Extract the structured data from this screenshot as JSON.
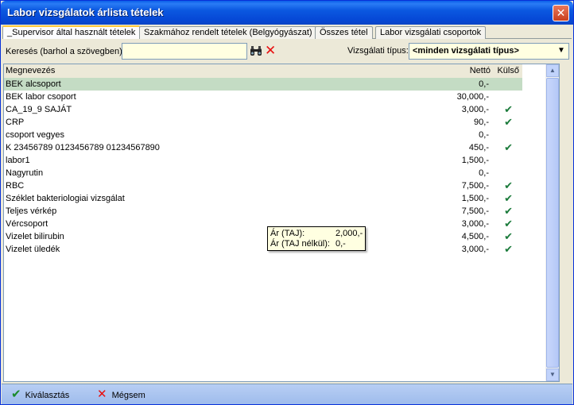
{
  "window": {
    "title": "Labor vizsgálatok árlista tételek",
    "close_glyph": "✕"
  },
  "tabs": [
    {
      "label": "_Supervisor által használt tételek",
      "active": true
    },
    {
      "label": "Szakmához rendelt tételek (Belgyógyászat)",
      "active": false
    },
    {
      "label": "Összes tétel",
      "active": false
    },
    {
      "label": "Labor vizsgálati csoportok",
      "active": false
    }
  ],
  "toolbar": {
    "search_label": "Keresés (barhol a szövegben):",
    "search_value": "",
    "search_icon": "binoculars-icon",
    "clear_icon": "clear-x-icon",
    "clear_glyph": "✕",
    "type_label": "Vizsgálati típus:",
    "type_value": "<minden vizsgálati típus>",
    "type_arrow": "▼"
  },
  "grid": {
    "columns": {
      "name": "Megnevezés",
      "net": "Nettó",
      "ext": "Külső"
    },
    "check_glyph": "✔",
    "rows": [
      {
        "name": "BEK alcsoport",
        "net": "0,-",
        "ext": false,
        "selected": true
      },
      {
        "name": "BEK labor csoport",
        "net": "30,000,-",
        "ext": false
      },
      {
        "name": "CA_19_9 SAJÁT",
        "net": "3,000,-",
        "ext": true
      },
      {
        "name": "CRP",
        "net": "90,-",
        "ext": true
      },
      {
        "name": "csoport vegyes",
        "net": "0,-",
        "ext": false
      },
      {
        "name": "K 23456789 0123456789 01234567890",
        "net": "450,-",
        "ext": true
      },
      {
        "name": "labor1",
        "net": "1,500,-",
        "ext": false
      },
      {
        "name": "Nagyrutin",
        "net": "0,-",
        "ext": false
      },
      {
        "name": "RBC",
        "net": "7,500,-",
        "ext": true
      },
      {
        "name": "Széklet bakteriologiai vizsgálat",
        "net": "1,500,-",
        "ext": true
      },
      {
        "name": "Teljes vérkép",
        "net": "7,500,-",
        "ext": true
      },
      {
        "name": "Vércsoport",
        "net": "3,000,-",
        "ext": true
      },
      {
        "name": "Vizelet bilirubin",
        "net": "4,500,-",
        "ext": true
      },
      {
        "name": "Vizelet üledék",
        "net": "3,000,-",
        "ext": true
      }
    ]
  },
  "tooltip": {
    "label1": "Ár (TAJ):",
    "value1": "2,000,-",
    "label2": "Ár (TAJ nélkül):",
    "value2": "0,-"
  },
  "bottom": {
    "ok_label": "Kiválasztás",
    "ok_glyph": "✔",
    "cancel_label": "Mégsem",
    "cancel_glyph": "✕"
  },
  "scrollbar": {
    "up_glyph": "▲",
    "down_glyph": "▼"
  }
}
